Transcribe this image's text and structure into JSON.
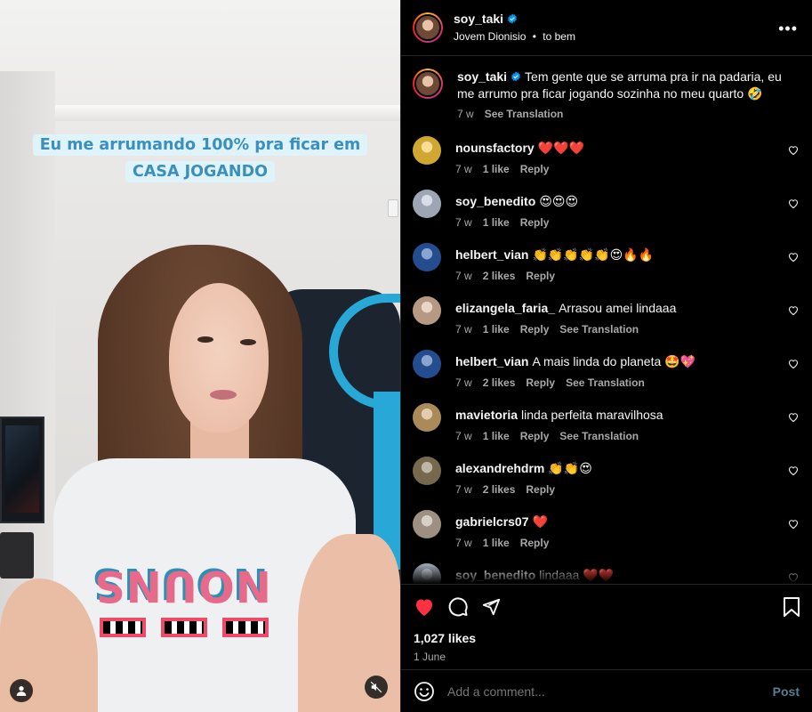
{
  "video": {
    "caption_line1": "Eu me arrumando 100% pra ficar em",
    "caption_line2": "CASA JOGANDO",
    "shirt_print": "NOUNS"
  },
  "header": {
    "username": "soy_taki",
    "song": "Jovem Dionisio",
    "song_sep": "•",
    "song_title": "to bem"
  },
  "post_caption": {
    "username": "soy_taki",
    "text": "Tem gente que se arruma pra ir na padaria, eu me arrumo pra ficar jogando sozinha no meu quarto 🤣",
    "time": "7 w",
    "see_translation": "See Translation"
  },
  "comments": [
    {
      "username": "nounsfactory",
      "text": "❤️❤️❤️",
      "time": "7 w",
      "likes": "1 like",
      "reply": "Reply",
      "translation": "",
      "avatar_color": "#f3c43a"
    },
    {
      "username": "soy_benedito",
      "text": "😍😍😍",
      "time": "7 w",
      "likes": "1 like",
      "reply": "Reply",
      "translation": "",
      "avatar_color": "#b9c3d3"
    },
    {
      "username": "helbert_vian",
      "text": "👏👏👏👏👏😍🔥🔥",
      "time": "7 w",
      "likes": "2 likes",
      "reply": "Reply",
      "translation": "",
      "avatar_color": "#2a5aa8"
    },
    {
      "username": "elizangela_faria_",
      "text": "Arrasou amei lindaaa",
      "time": "7 w",
      "likes": "1 like",
      "reply": "Reply",
      "translation": "See Translation",
      "avatar_color": "#d7b49a"
    },
    {
      "username": "helbert_vian",
      "text": "A mais linda do planeta 🤩💖",
      "time": "7 w",
      "likes": "2 likes",
      "reply": "Reply",
      "translation": "See Translation",
      "avatar_color": "#2a5aa8"
    },
    {
      "username": "mavietoria",
      "text": "linda perfeita maravilhosa",
      "time": "7 w",
      "likes": "1 like",
      "reply": "Reply",
      "translation": "See Translation",
      "avatar_color": "#c9a26a"
    },
    {
      "username": "alexandrehdrm",
      "text": "👏👏😍",
      "time": "7 w",
      "likes": "2 likes",
      "reply": "Reply",
      "translation": "",
      "avatar_color": "#8a7a5a"
    },
    {
      "username": "gabrielcrs07",
      "text": "❤️",
      "time": "7 w",
      "likes": "1 like",
      "reply": "Reply",
      "translation": "",
      "avatar_color": "#b8a898"
    },
    {
      "username": "soy_benedito",
      "text": "lindaaa ❤️❤️",
      "time": "",
      "likes": "",
      "reply": "",
      "translation": "",
      "avatar_color": "#b9c3d3"
    }
  ],
  "actions": {
    "likes": "1,027 likes",
    "date": "1 June"
  },
  "add_comment": {
    "placeholder": "Add a comment...",
    "post_label": "Post"
  },
  "colors": {
    "like_red": "#ff3040",
    "verified_blue": "#0095f6",
    "post_button": "#557e93"
  }
}
